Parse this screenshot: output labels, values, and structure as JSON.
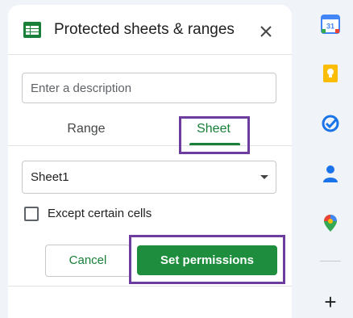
{
  "dialog": {
    "title": "Protected sheets & ranges",
    "description_placeholder": "Enter a description",
    "tabs": [
      {
        "label": "Range",
        "active": false
      },
      {
        "label": "Sheet",
        "active": true
      }
    ],
    "sheet_select": {
      "value": "Sheet1"
    },
    "checkbox": {
      "label": "Except certain cells",
      "checked": false
    },
    "buttons": {
      "cancel": "Cancel",
      "set_permissions": "Set permissions"
    }
  },
  "side_panel": {
    "apps": [
      "calendar-icon",
      "keep-icon",
      "tasks-icon",
      "contacts-icon",
      "maps-icon"
    ],
    "calendar_day": "31",
    "add_label": "+"
  },
  "colors": {
    "accent": "#188038",
    "highlight": "#6c3c9e"
  }
}
